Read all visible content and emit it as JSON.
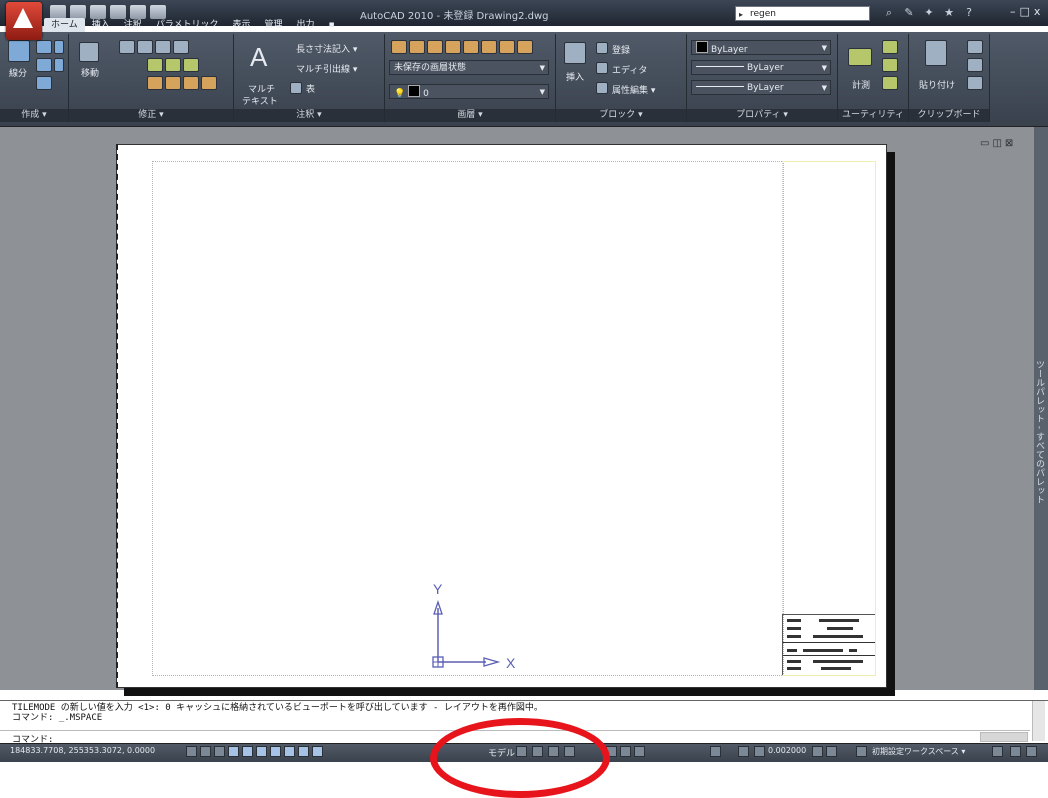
{
  "window": {
    "title": "AutoCAD 2010 - 未登録    Drawing2.dwg",
    "search_value": "regen",
    "controls": [
      "–",
      "□",
      "x"
    ]
  },
  "ribbon": {
    "tabs": [
      "ホーム",
      "挿入",
      "注釈",
      "パラメトリック",
      "表示",
      "管理",
      "出力"
    ],
    "panels": {
      "draw": {
        "title": "作成 ▾",
        "line_label": "線分"
      },
      "modify": {
        "title": "修正 ▾",
        "move_label": "移動"
      },
      "annotation": {
        "title": "注釈 ▾",
        "mtext_glyph": "A",
        "mtext_label_1": "マルチ",
        "mtext_label_2": "テキスト",
        "dimension": "長さ寸法記入 ▾",
        "leader": "マルチ引出線 ▾",
        "table": "表"
      },
      "layers": {
        "title": "画層 ▾",
        "state": "未保存の画層状態",
        "current_layer": "0"
      },
      "block": {
        "title": "ブロック ▾",
        "insert": "挿入",
        "create": "登録",
        "editor": "エディタ",
        "attribute": "属性編集 ▾"
      },
      "properties": {
        "title": "プロパティ ▾",
        "color": "ByLayer",
        "linetype": "ByLayer",
        "lineweight": "ByLayer"
      },
      "utilities": {
        "title": "ユーティリティ",
        "measure": "計測"
      },
      "clipboard": {
        "title": "クリップボード",
        "paste": "貼り付け"
      }
    }
  },
  "palette": {
    "label": "ツールパレット - すべてのパレット"
  },
  "ucs": {
    "x_label": "X",
    "y_label": "Y"
  },
  "command": {
    "history_1": "TILEMODE の新しい値を入力 <1>: 0 キャッシュに格納されているビューポートを呼び出しています - レイアウトを再作図中。",
    "history_2": "コマンド: _.MSPACE",
    "prompt": "コマンド:"
  },
  "status": {
    "coords": "184833.7708, 255353.3072, 0.0000",
    "model": "モデル",
    "scale": "0.002000",
    "workspace": "初期設定ワークスペース ▾"
  },
  "colors": {
    "annotation_circle": "#e8141c",
    "ribbon_bg": "#46505c"
  }
}
